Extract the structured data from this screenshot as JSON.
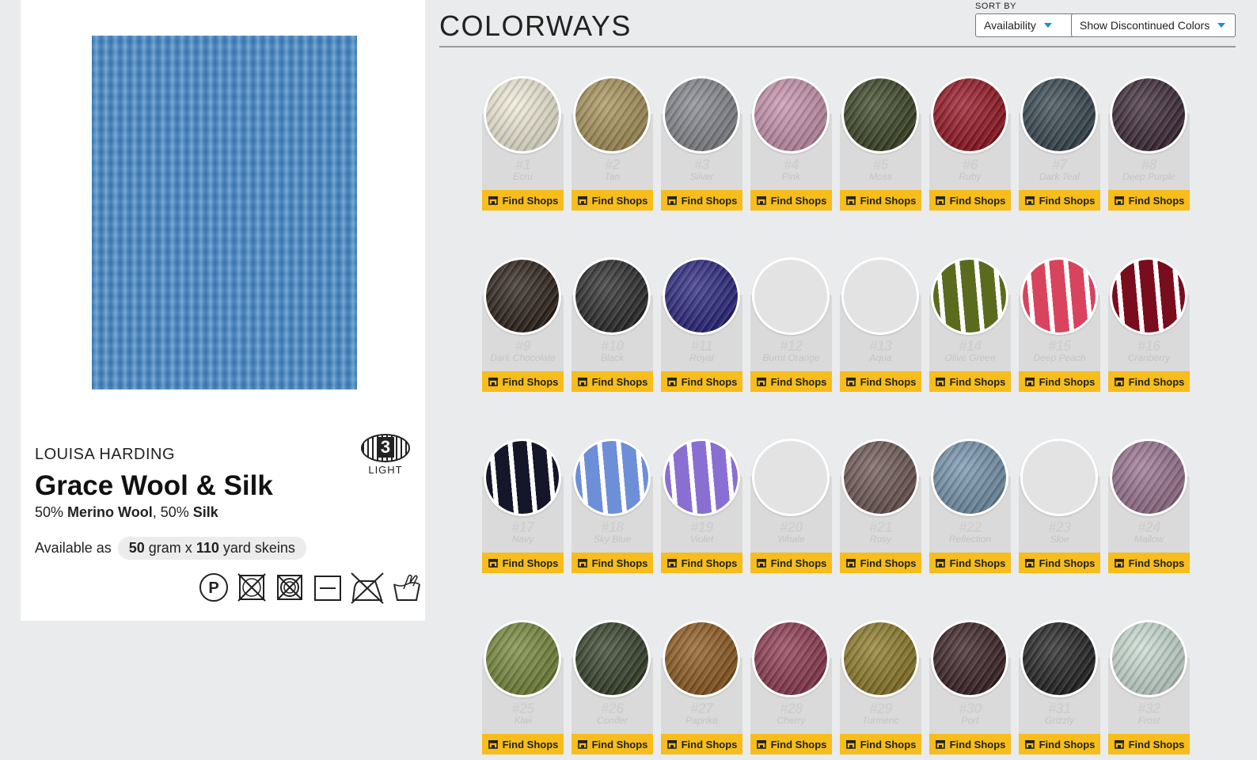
{
  "product": {
    "brand": "LOUISA HARDING",
    "name": "Grace Wool & Silk",
    "fiber_pct1": "50%",
    "fiber_name1": "Merino Wool",
    "fiber_sep": ",",
    "fiber_pct2": "50%",
    "fiber_name2": "Silk",
    "available_prefix": "Available as",
    "grams": "50",
    "grams_unit": "gram x",
    "yards": "110",
    "yards_unit": "yard skeins",
    "weight_number": "3",
    "weight_label": "LIGHT",
    "photo_color": "#4f8fc8",
    "care_icons": [
      "dry-clean-p-icon",
      "do-not-tumble-dry-icon",
      "do-not-machine-wash-icon",
      "dry-flat-icon",
      "do-not-iron-icon",
      "hand-wash-icon"
    ]
  },
  "colorways": {
    "heading": "COLORWAYS",
    "sort_label": "SORT BY",
    "sort_value": "Availability",
    "discontinued_value": "Show Discontinued Colors",
    "accent": "#1a8fd8",
    "button_color": "#f6bd1c",
    "find_label": "Find Shops",
    "items": [
      {
        "num": "#1",
        "name": "Ecru",
        "color": "#f1ecd8"
      },
      {
        "num": "#2",
        "name": "Tan",
        "color": "#a8935a"
      },
      {
        "num": "#3",
        "name": "Silver",
        "color": "#85878d"
      },
      {
        "num": "#4",
        "name": "Pink",
        "color": "#c892ad"
      },
      {
        "num": "#5",
        "name": "Moss",
        "color": "#3b4424"
      },
      {
        "num": "#6",
        "name": "Ruby",
        "color": "#951422"
      },
      {
        "num": "#7",
        "name": "Dark Teal",
        "color": "#374750"
      },
      {
        "num": "#8",
        "name": "Deep Purple",
        "color": "#3d2938"
      },
      {
        "num": "#9",
        "name": "Dark Chocolate",
        "color": "#2d2119"
      },
      {
        "num": "#10",
        "name": "Black",
        "color": "#2b2b2c"
      },
      {
        "num": "#11",
        "name": "Royal",
        "color": "#2a2680"
      },
      {
        "num": "#12",
        "name": "Burnt Orange",
        "color": ""
      },
      {
        "num": "#13",
        "name": "Aqua",
        "color": ""
      },
      {
        "num": "#14",
        "name": "Olive Green",
        "color": "#5b6b1e",
        "stripe": "#ffffff"
      },
      {
        "num": "#15",
        "name": "Deep Peach",
        "color": "#d8445e",
        "stripe": "#ffffff"
      },
      {
        "num": "#16",
        "name": "Cranberry",
        "color": "#7a0d1d",
        "stripe": "#ffffff"
      },
      {
        "num": "#17",
        "name": "Navy",
        "color": "#15162a",
        "stripe": "#ffffff"
      },
      {
        "num": "#18",
        "name": "Sky Blue",
        "color": "#6d8fd8",
        "stripe": "#ffffff"
      },
      {
        "num": "#19",
        "name": "Violet",
        "color": "#8a6fd2",
        "stripe": "#ffffff"
      },
      {
        "num": "#20",
        "name": "Whale",
        "color": ""
      },
      {
        "num": "#21",
        "name": "Rosy",
        "color": "#6e5854"
      },
      {
        "num": "#22",
        "name": "Reflection",
        "color": "#7594ad"
      },
      {
        "num": "#23",
        "name": "Sloe",
        "color": ""
      },
      {
        "num": "#24",
        "name": "Mallow",
        "color": "#9a7390"
      },
      {
        "num": "#25",
        "name": "Kiwi",
        "color": "#76883a"
      },
      {
        "num": "#26",
        "name": "Conifer",
        "color": "#35412a"
      },
      {
        "num": "#27",
        "name": "Paprika",
        "color": "#8f5a1f"
      },
      {
        "num": "#28",
        "name": "Cherry",
        "color": "#8e3a52"
      },
      {
        "num": "#29",
        "name": "Turmeric",
        "color": "#8d7a27"
      },
      {
        "num": "#30",
        "name": "Port",
        "color": "#3a2124"
      },
      {
        "num": "#31",
        "name": "Grizzly",
        "color": "#232222"
      },
      {
        "num": "#32",
        "name": "Frost",
        "color": "#c9dcd2"
      }
    ]
  }
}
